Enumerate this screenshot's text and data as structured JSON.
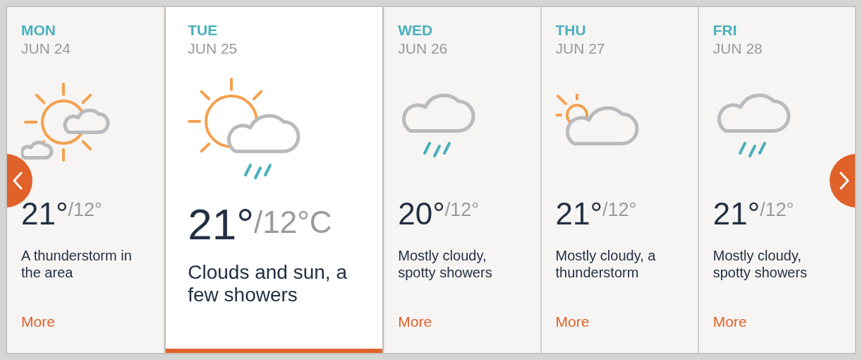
{
  "days": [
    {
      "day": "MON",
      "date": "JUN 24",
      "kind": "suncloudy",
      "high": "21°",
      "low": "/12°",
      "description": "A thunderstorm in the area",
      "link": "More",
      "selected": false
    },
    {
      "day": "TUE",
      "date": "JUN 25",
      "kind": "showers",
      "high": "21°",
      "low": "/12°C",
      "description": "Clouds and sun, a few showers",
      "selected": true
    },
    {
      "day": "WED",
      "date": "JUN 26",
      "kind": "rain",
      "high": "20°",
      "low": "/12°",
      "description": "Mostly cloudy, spotty showers",
      "link": "More",
      "selected": false
    },
    {
      "day": "THU",
      "date": "JUN 27",
      "kind": "cloudy",
      "high": "21°",
      "low": "/12°",
      "description": "Mostly cloudy, a thunderstorm",
      "link": "More",
      "selected": false
    },
    {
      "day": "FRI",
      "date": "JUN 28",
      "kind": "rain",
      "high": "21°",
      "low": "/12°",
      "description": "Mostly cloudy, spotty showers",
      "link": "More",
      "selected": false
    }
  ]
}
